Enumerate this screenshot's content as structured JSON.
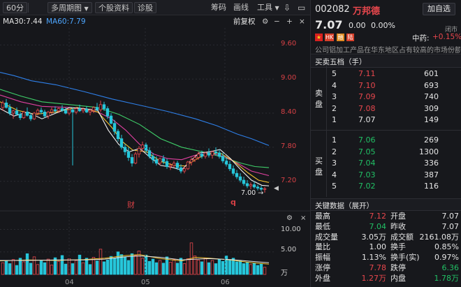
{
  "toolbar": {
    "period": "60分",
    "multi_period": "多周期图",
    "stock_info": "个股资料",
    "diagnose": "诊股",
    "chip": "筹码",
    "draw": "画线",
    "tools": "工具"
  },
  "indicators": {
    "ma30": "MA30:7.44",
    "ma60": "MA60:7.79",
    "adjust": "前复权"
  },
  "chart_data": {
    "type": "candlestick",
    "price_axis": [
      "9.60",
      "9.00",
      "8.40",
      "7.80",
      "7.20"
    ],
    "ylim": [
      6.95,
      9.9
    ],
    "last_price_marker": "7.00",
    "event_markers": [
      "财",
      "q"
    ],
    "volume_axis": [
      "10.00",
      "5.00"
    ],
    "volume_unit": "万",
    "months": [
      "04",
      "05",
      "06"
    ],
    "ma_colors": {
      "ma5": "#f0f0f0",
      "ma10": "#f2c230",
      "ma20": "#e040a0",
      "ma30": "#3fd06a",
      "ma60": "#2e7fe8"
    },
    "ma60_points": [
      [
        0,
        9.12
      ],
      [
        20,
        9.06
      ],
      [
        45,
        8.97
      ],
      [
        80,
        8.9
      ],
      [
        120,
        8.78
      ],
      [
        160,
        8.65
      ],
      [
        200,
        8.54
      ],
      [
        240,
        8.43
      ],
      [
        280,
        8.3
      ],
      [
        310,
        8.18
      ],
      [
        340,
        8.03
      ],
      [
        360,
        7.95
      ],
      [
        385,
        7.83
      ]
    ],
    "ma30_points": [
      [
        0,
        8.82
      ],
      [
        30,
        8.7
      ],
      [
        60,
        8.6
      ],
      [
        100,
        8.55
      ],
      [
        140,
        8.5
      ],
      [
        170,
        8.38
      ],
      [
        200,
        8.2
      ],
      [
        230,
        7.95
      ],
      [
        260,
        7.8
      ],
      [
        290,
        7.72
      ],
      [
        320,
        7.62
      ],
      [
        345,
        7.52
      ],
      [
        365,
        7.46
      ],
      [
        385,
        7.44
      ]
    ],
    "ma20_points": [
      [
        0,
        8.72
      ],
      [
        30,
        8.6
      ],
      [
        60,
        8.52
      ],
      [
        100,
        8.5
      ],
      [
        140,
        8.42
      ],
      [
        160,
        8.3
      ],
      [
        180,
        8.1
      ],
      [
        200,
        7.85
      ],
      [
        220,
        7.68
      ],
      [
        240,
        7.6
      ],
      [
        260,
        7.58
      ],
      [
        280,
        7.66
      ],
      [
        300,
        7.7
      ],
      [
        320,
        7.64
      ],
      [
        340,
        7.52
      ],
      [
        360,
        7.38
      ],
      [
        385,
        7.3
      ]
    ],
    "ma10_points": [
      [
        0,
        8.6
      ],
      [
        25,
        8.45
      ],
      [
        50,
        8.38
      ],
      [
        80,
        8.42
      ],
      [
        110,
        8.5
      ],
      [
        140,
        8.42
      ],
      [
        160,
        8.15
      ],
      [
        175,
        7.9
      ],
      [
        190,
        7.75
      ],
      [
        210,
        7.72
      ],
      [
        230,
        7.55
      ],
      [
        250,
        7.48
      ],
      [
        265,
        7.47
      ],
      [
        280,
        7.58
      ],
      [
        295,
        7.68
      ],
      [
        315,
        7.7
      ],
      [
        335,
        7.55
      ],
      [
        355,
        7.35
      ],
      [
        370,
        7.22
      ],
      [
        385,
        7.18
      ]
    ],
    "ma5_points": [
      [
        0,
        8.48
      ],
      [
        20,
        8.35
      ],
      [
        40,
        8.42
      ],
      [
        60,
        8.3
      ],
      [
        80,
        8.4
      ],
      [
        100,
        8.5
      ],
      [
        120,
        8.48
      ],
      [
        140,
        8.45
      ],
      [
        155,
        8.1
      ],
      [
        170,
        7.85
      ],
      [
        185,
        7.72
      ],
      [
        200,
        7.78
      ],
      [
        215,
        7.62
      ],
      [
        230,
        7.48
      ],
      [
        245,
        7.45
      ],
      [
        260,
        7.4
      ],
      [
        272,
        7.55
      ],
      [
        285,
        7.7
      ],
      [
        300,
        7.72
      ],
      [
        315,
        7.76
      ],
      [
        330,
        7.6
      ],
      [
        345,
        7.4
      ],
      [
        360,
        7.22
      ],
      [
        375,
        7.13
      ],
      [
        385,
        7.12
      ]
    ],
    "candles": [
      [
        4,
        8.5,
        8.62,
        8.44,
        8.58
      ],
      [
        9,
        8.58,
        8.65,
        8.48,
        8.5
      ],
      [
        14,
        8.5,
        8.56,
        8.36,
        8.4
      ],
      [
        19,
        8.4,
        8.46,
        8.3,
        8.44
      ],
      [
        24,
        8.44,
        8.5,
        8.36,
        8.38
      ],
      [
        29,
        8.38,
        8.42,
        8.28,
        8.32
      ],
      [
        34,
        8.32,
        8.44,
        8.3,
        8.42
      ],
      [
        39,
        8.42,
        8.5,
        8.34,
        8.36
      ],
      [
        44,
        8.36,
        8.4,
        8.26,
        8.3
      ],
      [
        49,
        8.3,
        8.42,
        8.28,
        8.4
      ],
      [
        54,
        8.4,
        8.48,
        8.36,
        8.45
      ],
      [
        59,
        8.45,
        8.5,
        8.38,
        8.42
      ],
      [
        64,
        8.42,
        8.46,
        8.32,
        8.35
      ],
      [
        69,
        8.35,
        8.44,
        8.3,
        8.42
      ],
      [
        74,
        8.42,
        8.5,
        8.38,
        8.46
      ],
      [
        79,
        8.46,
        8.52,
        8.4,
        8.44
      ],
      [
        84,
        8.44,
        8.5,
        8.4,
        8.48
      ],
      [
        89,
        8.48,
        8.54,
        8.42,
        8.45
      ],
      [
        94,
        8.45,
        8.5,
        8.38,
        8.4
      ],
      [
        99,
        8.4,
        8.48,
        8.36,
        8.46
      ],
      [
        104,
        8.46,
        8.5,
        7.48,
        8.42
      ],
      [
        109,
        8.42,
        8.5,
        8.38,
        8.48
      ],
      [
        114,
        8.48,
        8.55,
        8.42,
        8.44
      ],
      [
        119,
        8.44,
        8.5,
        8.4,
        8.47
      ],
      [
        124,
        8.47,
        8.52,
        8.4,
        8.42
      ],
      [
        129,
        8.42,
        8.48,
        8.36,
        8.45
      ],
      [
        134,
        8.45,
        8.52,
        8.4,
        8.5
      ],
      [
        139,
        8.5,
        8.58,
        8.44,
        8.46
      ],
      [
        144,
        8.46,
        8.62,
        8.42,
        8.55
      ],
      [
        149,
        8.55,
        8.6,
        8.44,
        8.48
      ],
      [
        154,
        8.48,
        8.52,
        8.3,
        8.35
      ],
      [
        159,
        8.35,
        8.4,
        8.2,
        8.22
      ],
      [
        164,
        8.22,
        8.28,
        8.02,
        8.08
      ],
      [
        169,
        8.08,
        8.12,
        7.9,
        7.95
      ],
      [
        174,
        7.95,
        8.02,
        7.76,
        7.8
      ],
      [
        179,
        7.8,
        7.86,
        7.66,
        7.72
      ],
      [
        184,
        7.72,
        7.8,
        7.56,
        7.62
      ],
      [
        189,
        7.62,
        7.68,
        7.46,
        7.52
      ],
      [
        194,
        7.52,
        7.72,
        7.5,
        7.68
      ],
      [
        199,
        7.68,
        7.82,
        7.62,
        7.78
      ],
      [
        204,
        7.78,
        7.9,
        7.72,
        7.84
      ],
      [
        209,
        7.84,
        7.88,
        7.7,
        7.74
      ],
      [
        214,
        7.74,
        7.8,
        7.6,
        7.64
      ],
      [
        219,
        7.64,
        7.7,
        7.52,
        7.58
      ],
      [
        224,
        7.58,
        7.64,
        7.48,
        7.52
      ],
      [
        229,
        7.52,
        7.62,
        7.48,
        7.6
      ],
      [
        234,
        7.6,
        7.66,
        7.5,
        7.55
      ],
      [
        239,
        7.55,
        7.6,
        7.42,
        7.46
      ],
      [
        244,
        7.46,
        7.52,
        7.4,
        7.48
      ],
      [
        249,
        7.48,
        7.56,
        7.44,
        7.52
      ],
      [
        254,
        7.52,
        7.56,
        7.4,
        7.44
      ],
      [
        259,
        7.44,
        7.5,
        7.34,
        7.38
      ],
      [
        264,
        7.38,
        7.46,
        7.34,
        7.42
      ],
      [
        269,
        7.42,
        7.56,
        7.4,
        7.54
      ],
      [
        274,
        7.54,
        7.62,
        7.48,
        7.58
      ],
      [
        279,
        7.58,
        7.66,
        7.54,
        7.62
      ],
      [
        284,
        7.62,
        7.72,
        7.58,
        7.68
      ],
      [
        289,
        7.68,
        7.74,
        7.6,
        7.64
      ],
      [
        294,
        7.64,
        7.72,
        7.6,
        7.7
      ],
      [
        299,
        7.7,
        7.78,
        7.62,
        7.66
      ],
      [
        304,
        7.66,
        7.74,
        7.6,
        7.72
      ],
      [
        309,
        7.72,
        7.8,
        7.66,
        7.7
      ],
      [
        314,
        7.7,
        7.76,
        7.6,
        7.64
      ],
      [
        319,
        7.64,
        7.7,
        7.52,
        7.56
      ],
      [
        324,
        7.56,
        7.62,
        7.46,
        7.5
      ],
      [
        329,
        7.5,
        7.56,
        7.38,
        7.42
      ],
      [
        334,
        7.42,
        7.48,
        7.3,
        7.34
      ],
      [
        339,
        7.34,
        7.4,
        7.24,
        7.28
      ],
      [
        344,
        7.28,
        7.34,
        7.18,
        7.22
      ],
      [
        349,
        7.22,
        7.28,
        7.12,
        7.16
      ],
      [
        354,
        7.16,
        7.22,
        7.08,
        7.12
      ],
      [
        359,
        7.12,
        7.18,
        7.06,
        7.14
      ],
      [
        364,
        7.14,
        7.2,
        7.07,
        7.1
      ],
      [
        369,
        7.1,
        7.14,
        7.04,
        7.08
      ],
      [
        374,
        7.08,
        7.12,
        7.03,
        7.06
      ],
      [
        379,
        7.06,
        7.1,
        7.0,
        7.07
      ]
    ],
    "volumes": [
      [
        4,
        2.6,
        0
      ],
      [
        9,
        3.1,
        1
      ],
      [
        14,
        2.4,
        1
      ],
      [
        19,
        3.3,
        0
      ],
      [
        24,
        2.0,
        1
      ],
      [
        29,
        3.6,
        1
      ],
      [
        34,
        2.8,
        0
      ],
      [
        39,
        4.6,
        1
      ],
      [
        44,
        2.5,
        1
      ],
      [
        49,
        3.9,
        0
      ],
      [
        54,
        2.2,
        0
      ],
      [
        59,
        3.0,
        1
      ],
      [
        64,
        2.6,
        1
      ],
      [
        69,
        3.4,
        0
      ],
      [
        74,
        2.1,
        0
      ],
      [
        79,
        3.7,
        1
      ],
      [
        84,
        2.9,
        0
      ],
      [
        89,
        4.2,
        1
      ],
      [
        94,
        2.3,
        1
      ],
      [
        99,
        3.5,
        0
      ],
      [
        104,
        2.4,
        1
      ],
      [
        109,
        3.1,
        0
      ],
      [
        114,
        4.3,
        1
      ],
      [
        119,
        2.6,
        0
      ],
      [
        124,
        3.6,
        1
      ],
      [
        129,
        2.2,
        1
      ],
      [
        134,
        3.8,
        0
      ],
      [
        139,
        3.0,
        1
      ],
      [
        144,
        5.6,
        0
      ],
      [
        149,
        2.8,
        1
      ],
      [
        154,
        3.2,
        1
      ],
      [
        159,
        4.0,
        1
      ],
      [
        164,
        3.6,
        1
      ],
      [
        169,
        5.0,
        1
      ],
      [
        174,
        4.4,
        1
      ],
      [
        179,
        3.9,
        1
      ],
      [
        184,
        3.1,
        1
      ],
      [
        189,
        4.6,
        1
      ],
      [
        194,
        4.2,
        0
      ],
      [
        199,
        5.2,
        0
      ],
      [
        204,
        3.6,
        0
      ],
      [
        209,
        4.3,
        1
      ],
      [
        214,
        2.9,
        1
      ],
      [
        219,
        3.4,
        1
      ],
      [
        224,
        2.6,
        1
      ],
      [
        229,
        3.1,
        0
      ],
      [
        234,
        2.5,
        1
      ],
      [
        239,
        3.9,
        1
      ],
      [
        244,
        2.7,
        0
      ],
      [
        249,
        3.3,
        0
      ],
      [
        254,
        2.5,
        1
      ],
      [
        259,
        3.6,
        1
      ],
      [
        264,
        2.4,
        0
      ],
      [
        269,
        3.5,
        0
      ],
      [
        274,
        7.0,
        0
      ],
      [
        279,
        4.1,
        0
      ],
      [
        284,
        3.2,
        0
      ],
      [
        289,
        2.8,
        1
      ],
      [
        294,
        3.6,
        0
      ],
      [
        299,
        2.6,
        1
      ],
      [
        304,
        3.1,
        0
      ],
      [
        309,
        2.4,
        1
      ],
      [
        314,
        3.4,
        1
      ],
      [
        319,
        2.9,
        1
      ],
      [
        324,
        4.1,
        1
      ],
      [
        329,
        3.3,
        1
      ],
      [
        334,
        3.6,
        1
      ],
      [
        339,
        2.8,
        1
      ],
      [
        344,
        3.1,
        1
      ],
      [
        349,
        2.4,
        1
      ],
      [
        354,
        2.7,
        1
      ],
      [
        359,
        2.2,
        0
      ],
      [
        364,
        2.5,
        1
      ],
      [
        369,
        2.0,
        1
      ],
      [
        374,
        2.3,
        1
      ],
      [
        379,
        1.6,
        0
      ]
    ],
    "vol_ma5": [
      [
        0,
        3.0
      ],
      [
        40,
        3.2
      ],
      [
        80,
        3.1
      ],
      [
        120,
        3.3
      ],
      [
        150,
        3.6
      ],
      [
        180,
        4.2
      ],
      [
        200,
        4.4
      ],
      [
        230,
        3.5
      ],
      [
        260,
        3.0
      ],
      [
        280,
        3.8
      ],
      [
        300,
        3.6
      ],
      [
        330,
        3.2
      ],
      [
        360,
        2.6
      ],
      [
        385,
        2.3
      ]
    ],
    "vol_ma10": [
      [
        0,
        3.1
      ],
      [
        40,
        3.1
      ],
      [
        80,
        3.2
      ],
      [
        120,
        3.2
      ],
      [
        150,
        3.4
      ],
      [
        180,
        3.9
      ],
      [
        200,
        4.1
      ],
      [
        230,
        3.8
      ],
      [
        260,
        3.2
      ],
      [
        280,
        3.4
      ],
      [
        300,
        3.5
      ],
      [
        330,
        3.3
      ],
      [
        360,
        2.9
      ],
      [
        385,
        2.6
      ]
    ]
  },
  "stock": {
    "code": "002082",
    "name": "万邦德",
    "add_button": "加自选",
    "price": "7.07",
    "change": "0.00",
    "change_pct": "0.00%",
    "status": "闭市",
    "sector_label": "中药:",
    "sector_pct": "+0.15%",
    "tags": [
      "HK",
      "融",
      "陆"
    ],
    "desc": "公司铝加工产品在华东地区占有较高的市场份额"
  },
  "orderbook": {
    "title": "买卖五档（手）",
    "sell_label": [
      "卖",
      "盘"
    ],
    "buy_label": [
      "买",
      "盘"
    ],
    "sell": [
      {
        "level": "5",
        "price": "7.11",
        "vol": "601"
      },
      {
        "level": "4",
        "price": "7.10",
        "vol": "693"
      },
      {
        "level": "3",
        "price": "7.09",
        "vol": "740"
      },
      {
        "level": "2",
        "price": "7.08",
        "vol": "309"
      },
      {
        "level": "1",
        "price": "7.07",
        "vol": "149"
      }
    ],
    "buy": [
      {
        "level": "1",
        "price": "7.06",
        "vol": "269"
      },
      {
        "level": "2",
        "price": "7.05",
        "vol": "1300"
      },
      {
        "level": "3",
        "price": "7.04",
        "vol": "336"
      },
      {
        "level": "4",
        "price": "7.03",
        "vol": "387"
      },
      {
        "level": "5",
        "price": "7.02",
        "vol": "116"
      }
    ]
  },
  "keydata": {
    "title": "关键数据（展开）",
    "rows": [
      {
        "l1": "最高",
        "v1": "7.12",
        "c1": "red",
        "l2": "开盘",
        "v2": "7.07",
        "c2": "white"
      },
      {
        "l1": "最低",
        "v1": "7.04",
        "c1": "green",
        "l2": "昨收",
        "v2": "7.07",
        "c2": "white"
      },
      {
        "l1": "成交量",
        "v1": "3.05万",
        "c1": "white",
        "l2": "成交额",
        "v2": "2161.08万",
        "c2": "white"
      },
      {
        "l1": "量比",
        "v1": "1.00",
        "c1": "white",
        "l2": "换手",
        "v2": "0.85%",
        "c2": "white"
      },
      {
        "l1": "振幅",
        "v1": "1.13%",
        "c1": "white",
        "l2": "换手(实)",
        "v2": "0.97%",
        "c2": "white"
      },
      {
        "l1": "涨停",
        "v1": "7.78",
        "c1": "red",
        "l2": "跌停",
        "v2": "6.36",
        "c2": "green"
      },
      {
        "l1": "外盘",
        "v1": "1.27万",
        "c1": "red",
        "l2": "内盘",
        "v2": "1.78万",
        "c2": "green"
      }
    ]
  }
}
